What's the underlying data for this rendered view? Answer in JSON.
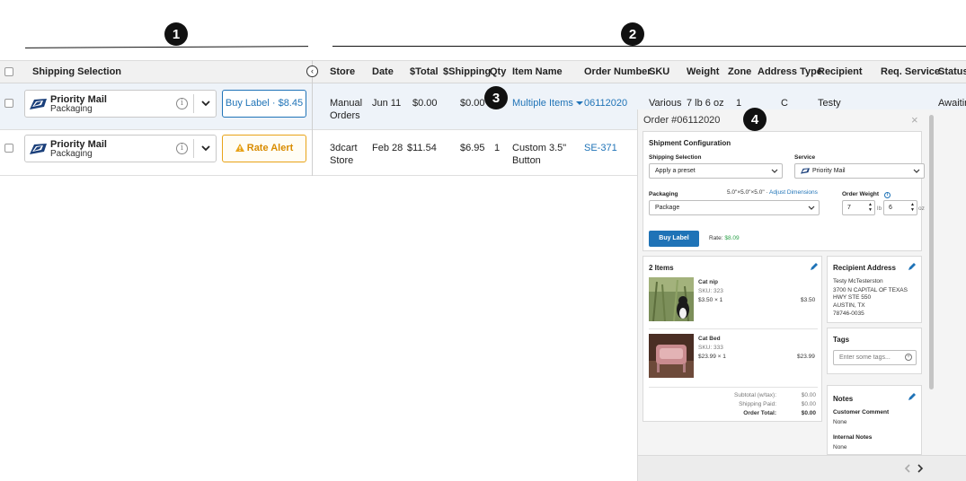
{
  "callouts": [
    "1",
    "2",
    "3",
    "4"
  ],
  "columns": {
    "shipping_selection": "Shipping Selection",
    "store": "Store",
    "date": "Date",
    "total": "$Total",
    "shipping": "$Shipping",
    "qty": "Qty",
    "item_name": "Item Name",
    "order_number": "Order Number",
    "sku": "SKU",
    "weight": "Weight",
    "zone": "Zone",
    "address_type": "Address Type",
    "recipient": "Recipient",
    "req_service": "Req. Service",
    "status": "Status"
  },
  "rows": [
    {
      "carrier": "Priority Mail",
      "packaging": "Packaging",
      "action": "Buy Label · $8.45",
      "store": [
        "Manual",
        "Orders"
      ],
      "date": "Jun 11",
      "total": "$0.00",
      "shipping": "$0.00",
      "item_name": "Multiple Items",
      "order_number": "06112020",
      "sku": "Various",
      "weight": "7 lb 6 oz",
      "zone": "1",
      "address_type": "C",
      "recipient": "Testy",
      "status": "Awaitin"
    },
    {
      "carrier": "Priority Mail",
      "packaging": "Packaging",
      "action": "Rate Alert",
      "store": [
        "3dcart",
        "Store"
      ],
      "date": "Feb 28",
      "total": "$11.54",
      "shipping": "$6.95",
      "qty": "1",
      "item_name": [
        "Custom 3.5\"",
        "Button"
      ],
      "order_number": "SE-371"
    }
  ],
  "panel": {
    "title": "Order #06112020",
    "close": "×",
    "shipment": {
      "title": "Shipment Configuration",
      "shipping_selection_label": "Shipping Selection",
      "shipping_selection_value": "Apply a preset",
      "service_label": "Service",
      "service_value": "Priority Mail",
      "packaging_label": "Packaging",
      "dimensions": "5.0\"×5.0\"×5.0\" · ",
      "adjust_dimensions": "Adjust Dimensions",
      "packaging_value": "Package",
      "order_weight_label": "Order Weight",
      "weight_lb": "7",
      "lb_unit": "lb",
      "weight_oz": "6",
      "oz_unit": "oz",
      "buy_label": "Buy Label",
      "rate_label": "Rate: ",
      "rate_value": "$8.09"
    },
    "items": {
      "title": "2 Items",
      "list": [
        {
          "name": "Cat nip",
          "sku": "SKU: 323",
          "price_qty": "$3.50 × 1",
          "total": "$3.50"
        },
        {
          "name": "Cat Bed",
          "sku": "SKU: 333",
          "price_qty": "$23.99 × 1",
          "total": "$23.99"
        }
      ],
      "subtotal_label": "Subtotal (w/tax):",
      "subtotal_value": "$0.00",
      "shipping_paid_label": "Shipping Paid:",
      "shipping_paid_value": "$0.00",
      "order_total_label": "Order Total:",
      "order_total_value": "$0.00"
    },
    "recipient": {
      "title": "Recipient Address",
      "lines": [
        "Testy McTesterston",
        "3700 N CAPITAL OF TEXAS",
        "HWY STE 550",
        "AUSTIN, TX",
        "78746-0035"
      ]
    },
    "tags": {
      "title": "Tags",
      "placeholder": "Enter some tags..."
    },
    "notes": {
      "title": "Notes",
      "customer_comment_label": "Customer Comment",
      "customer_comment_value": "None",
      "internal_notes_label": "Internal Notes",
      "internal_notes_value": "None"
    }
  },
  "colors": {
    "accent": "#1f73b7",
    "alert": "#e8a317",
    "rate_green": "#2ca24a"
  },
  "icons": [
    "usps-eagle-icon",
    "info-icon",
    "chevron-down-icon",
    "warning-icon",
    "collapse-left-icon",
    "close-icon",
    "pencil-icon",
    "add-circle-icon",
    "prev-icon",
    "next-icon"
  ]
}
